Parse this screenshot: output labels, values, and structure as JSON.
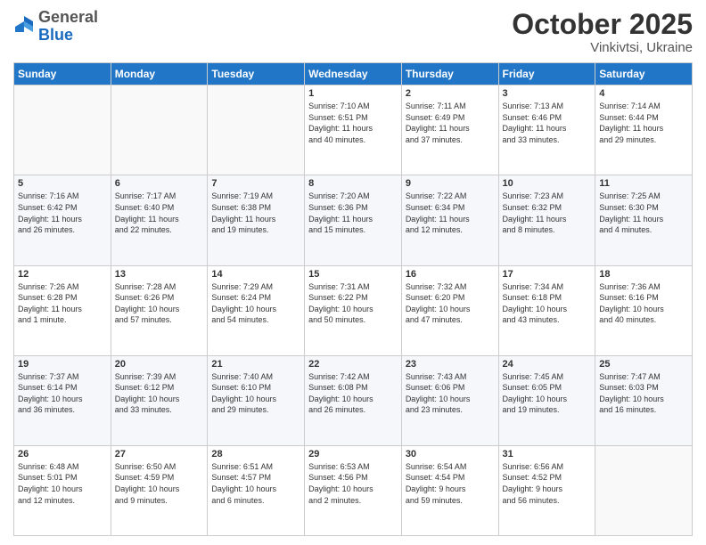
{
  "logo": {
    "general": "General",
    "blue": "Blue"
  },
  "title": "October 2025",
  "subtitle": "Vinkivtsi, Ukraine",
  "days_of_week": [
    "Sunday",
    "Monday",
    "Tuesday",
    "Wednesday",
    "Thursday",
    "Friday",
    "Saturday"
  ],
  "weeks": [
    [
      {
        "day": "",
        "info": ""
      },
      {
        "day": "",
        "info": ""
      },
      {
        "day": "",
        "info": ""
      },
      {
        "day": "1",
        "info": "Sunrise: 7:10 AM\nSunset: 6:51 PM\nDaylight: 11 hours\nand 40 minutes."
      },
      {
        "day": "2",
        "info": "Sunrise: 7:11 AM\nSunset: 6:49 PM\nDaylight: 11 hours\nand 37 minutes."
      },
      {
        "day": "3",
        "info": "Sunrise: 7:13 AM\nSunset: 6:46 PM\nDaylight: 11 hours\nand 33 minutes."
      },
      {
        "day": "4",
        "info": "Sunrise: 7:14 AM\nSunset: 6:44 PM\nDaylight: 11 hours\nand 29 minutes."
      }
    ],
    [
      {
        "day": "5",
        "info": "Sunrise: 7:16 AM\nSunset: 6:42 PM\nDaylight: 11 hours\nand 26 minutes."
      },
      {
        "day": "6",
        "info": "Sunrise: 7:17 AM\nSunset: 6:40 PM\nDaylight: 11 hours\nand 22 minutes."
      },
      {
        "day": "7",
        "info": "Sunrise: 7:19 AM\nSunset: 6:38 PM\nDaylight: 11 hours\nand 19 minutes."
      },
      {
        "day": "8",
        "info": "Sunrise: 7:20 AM\nSunset: 6:36 PM\nDaylight: 11 hours\nand 15 minutes."
      },
      {
        "day": "9",
        "info": "Sunrise: 7:22 AM\nSunset: 6:34 PM\nDaylight: 11 hours\nand 12 minutes."
      },
      {
        "day": "10",
        "info": "Sunrise: 7:23 AM\nSunset: 6:32 PM\nDaylight: 11 hours\nand 8 minutes."
      },
      {
        "day": "11",
        "info": "Sunrise: 7:25 AM\nSunset: 6:30 PM\nDaylight: 11 hours\nand 4 minutes."
      }
    ],
    [
      {
        "day": "12",
        "info": "Sunrise: 7:26 AM\nSunset: 6:28 PM\nDaylight: 11 hours\nand 1 minute."
      },
      {
        "day": "13",
        "info": "Sunrise: 7:28 AM\nSunset: 6:26 PM\nDaylight: 10 hours\nand 57 minutes."
      },
      {
        "day": "14",
        "info": "Sunrise: 7:29 AM\nSunset: 6:24 PM\nDaylight: 10 hours\nand 54 minutes."
      },
      {
        "day": "15",
        "info": "Sunrise: 7:31 AM\nSunset: 6:22 PM\nDaylight: 10 hours\nand 50 minutes."
      },
      {
        "day": "16",
        "info": "Sunrise: 7:32 AM\nSunset: 6:20 PM\nDaylight: 10 hours\nand 47 minutes."
      },
      {
        "day": "17",
        "info": "Sunrise: 7:34 AM\nSunset: 6:18 PM\nDaylight: 10 hours\nand 43 minutes."
      },
      {
        "day": "18",
        "info": "Sunrise: 7:36 AM\nSunset: 6:16 PM\nDaylight: 10 hours\nand 40 minutes."
      }
    ],
    [
      {
        "day": "19",
        "info": "Sunrise: 7:37 AM\nSunset: 6:14 PM\nDaylight: 10 hours\nand 36 minutes."
      },
      {
        "day": "20",
        "info": "Sunrise: 7:39 AM\nSunset: 6:12 PM\nDaylight: 10 hours\nand 33 minutes."
      },
      {
        "day": "21",
        "info": "Sunrise: 7:40 AM\nSunset: 6:10 PM\nDaylight: 10 hours\nand 29 minutes."
      },
      {
        "day": "22",
        "info": "Sunrise: 7:42 AM\nSunset: 6:08 PM\nDaylight: 10 hours\nand 26 minutes."
      },
      {
        "day": "23",
        "info": "Sunrise: 7:43 AM\nSunset: 6:06 PM\nDaylight: 10 hours\nand 23 minutes."
      },
      {
        "day": "24",
        "info": "Sunrise: 7:45 AM\nSunset: 6:05 PM\nDaylight: 10 hours\nand 19 minutes."
      },
      {
        "day": "25",
        "info": "Sunrise: 7:47 AM\nSunset: 6:03 PM\nDaylight: 10 hours\nand 16 minutes."
      }
    ],
    [
      {
        "day": "26",
        "info": "Sunrise: 6:48 AM\nSunset: 5:01 PM\nDaylight: 10 hours\nand 12 minutes."
      },
      {
        "day": "27",
        "info": "Sunrise: 6:50 AM\nSunset: 4:59 PM\nDaylight: 10 hours\nand 9 minutes."
      },
      {
        "day": "28",
        "info": "Sunrise: 6:51 AM\nSunset: 4:57 PM\nDaylight: 10 hours\nand 6 minutes."
      },
      {
        "day": "29",
        "info": "Sunrise: 6:53 AM\nSunset: 4:56 PM\nDaylight: 10 hours\nand 2 minutes."
      },
      {
        "day": "30",
        "info": "Sunrise: 6:54 AM\nSunset: 4:54 PM\nDaylight: 9 hours\nand 59 minutes."
      },
      {
        "day": "31",
        "info": "Sunrise: 6:56 AM\nSunset: 4:52 PM\nDaylight: 9 hours\nand 56 minutes."
      },
      {
        "day": "",
        "info": ""
      }
    ]
  ]
}
